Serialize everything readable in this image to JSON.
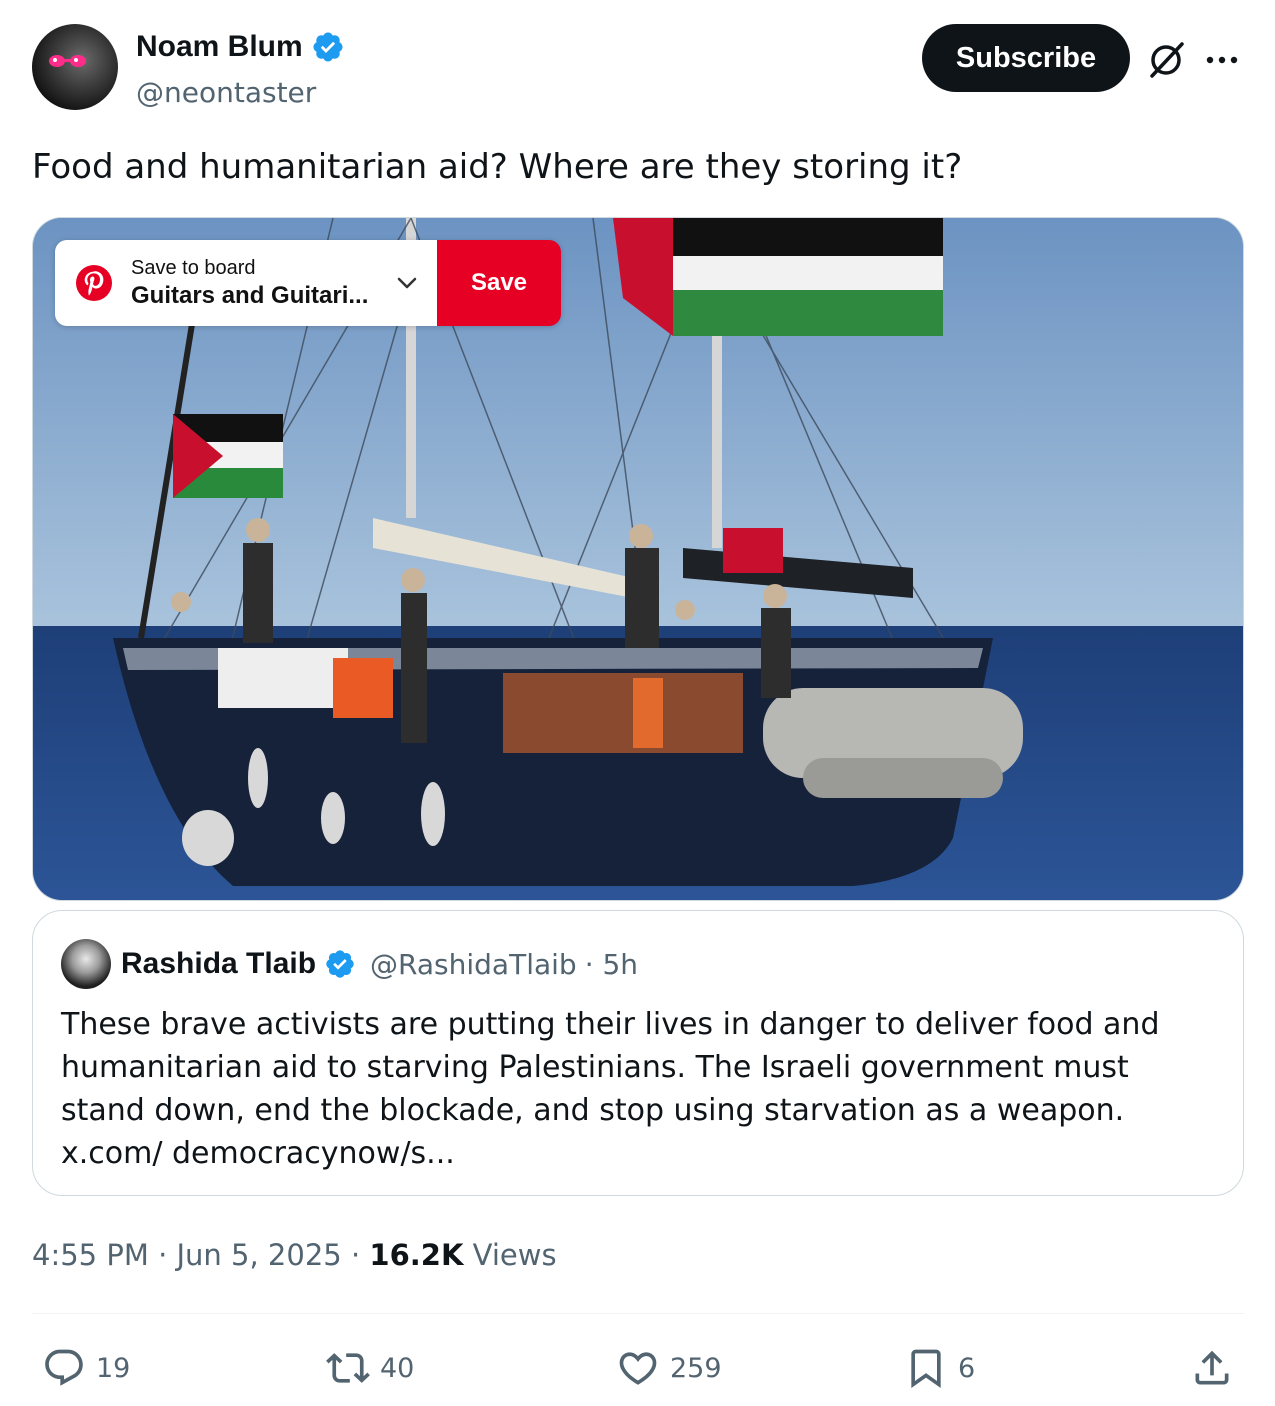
{
  "author": {
    "name": "Noam Blum",
    "handle": "@neontaster"
  },
  "header": {
    "subscribe_label": "Subscribe"
  },
  "tweet": {
    "text": "Food and humanitarian aid? Where are they storing it?"
  },
  "pinterest": {
    "top_label": "Save to board",
    "board_name": "Guitars and Guitari...",
    "save_label": "Save"
  },
  "quote": {
    "name": "Rashida Tlaib",
    "handle": "@RashidaTlaib",
    "time": "· 5h",
    "text": "These brave activists are putting their lives in danger to deliver food and humanitarian aid to starving Palestinians. The Israeli government must stand down, end the blockade, and stop using starvation as a weapon. x.com/ democracynow/s..."
  },
  "meta": {
    "time": "4:55 PM · Jun 5, 2025 · ",
    "views_count": "16.2K",
    "views_label": " Views"
  },
  "actions": {
    "replies": "19",
    "reposts": "40",
    "likes": "259",
    "bookmarks": "6"
  },
  "colors": {
    "verified": "#1d9bf0",
    "pinterest_red": "#e60023",
    "text_primary": "#0f1419",
    "text_secondary": "#536471"
  }
}
